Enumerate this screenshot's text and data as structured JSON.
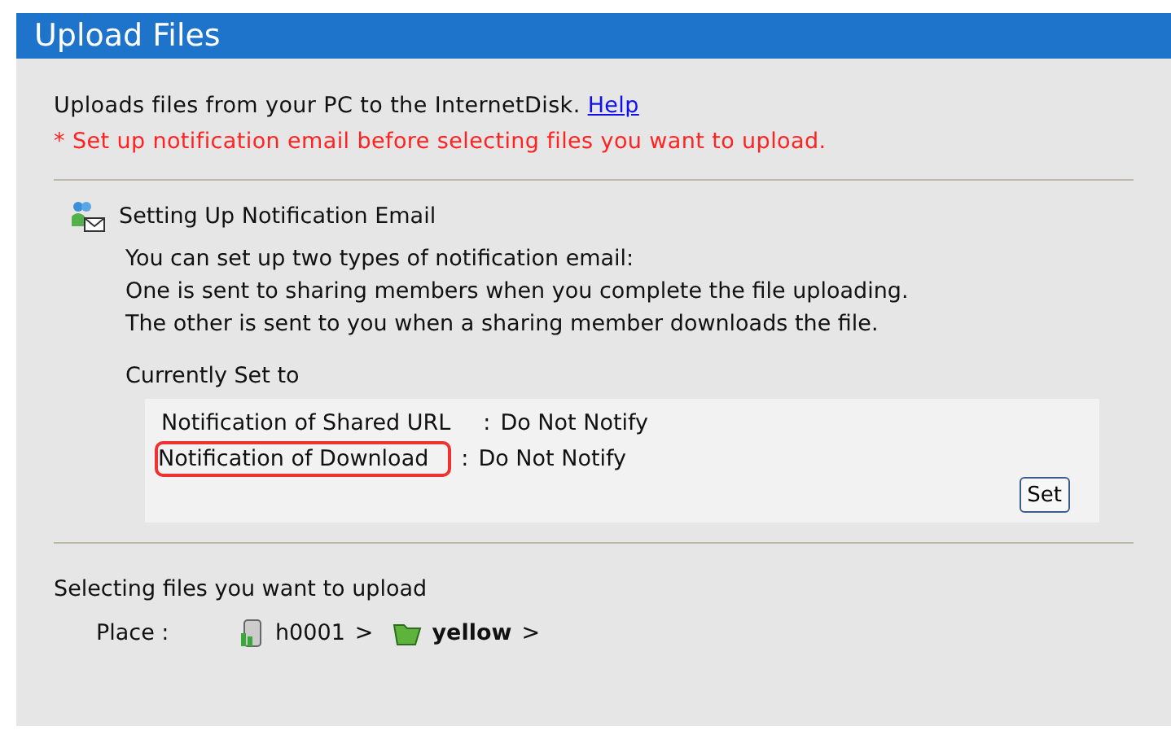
{
  "header": {
    "title": "Upload Files"
  },
  "intro": {
    "text": "Uploads files from your PC to the InternetDisk.",
    "link": "Help",
    "warning": "* Set up notification email before selecting files you want to upload."
  },
  "notification": {
    "title": "Setting Up Notification Email",
    "lines": [
      "You can set up two types of notification email:",
      "One is sent to sharing members when you complete the file uploading.",
      "The other is sent to you when a sharing member downloads the file."
    ],
    "current_label": "Currently Set to",
    "settings": [
      {
        "label": "Notification of Shared URL",
        "separator": ":",
        "value": "Do Not Notify",
        "highlighted": false
      },
      {
        "label": "Notification of Download",
        "separator": ":",
        "value": "Do Not Notify",
        "highlighted": true
      }
    ],
    "button": "Set"
  },
  "selection": {
    "title": "Selecting files you want to upload",
    "place_label": "Place :",
    "path": [
      {
        "kind": "drive",
        "name": "h0001",
        "current": false,
        "separator": ">"
      },
      {
        "kind": "folder",
        "name": "yellow",
        "current": true,
        "separator": ">"
      }
    ]
  }
}
